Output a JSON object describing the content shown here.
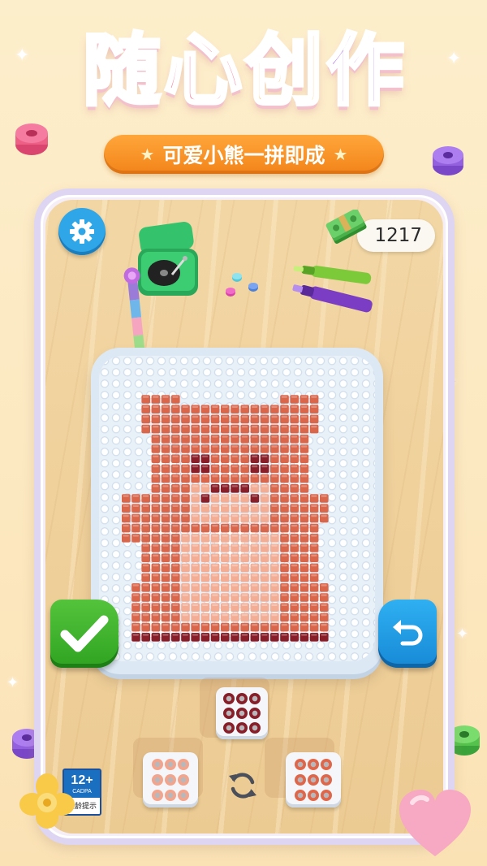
{
  "header": {
    "title_chars": [
      "随",
      "心",
      "创",
      "作"
    ],
    "title_colors": [
      "#f46a8e",
      "#f87b9c",
      "#f6a21e",
      "#b57be8"
    ],
    "subtitle": "可爱小熊一拼即成"
  },
  "hud": {
    "coins": "1217",
    "settings_icon": "gear-icon",
    "confirm_icon": "checkmark-icon",
    "undo_icon": "undo-arrow-icon",
    "refresh_icon": "refresh-icon"
  },
  "bead_trays": [
    {
      "name": "dark-red-beads",
      "color": "#8a1e28"
    },
    {
      "name": "light-pink-beads",
      "color": "#f3a48c"
    },
    {
      "name": "coral-beads",
      "color": "#e0664a"
    }
  ],
  "age_rating": {
    "age": "12+",
    "org": "CADPA",
    "hint": "适龄提示"
  },
  "colors": {
    "bear_body": "#d9654a",
    "bear_light": "#f3ad95",
    "bear_dark": "#8a1e28",
    "confirm_green": "#3cb02c",
    "undo_blue": "#1f9be5"
  }
}
